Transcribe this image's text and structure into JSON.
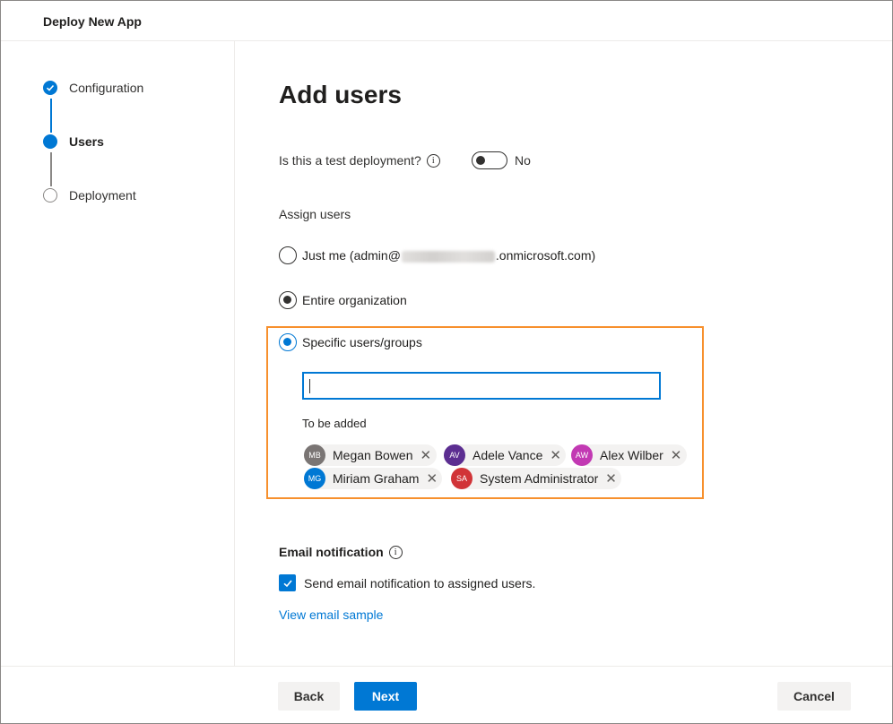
{
  "window": {
    "title": "Deploy New App"
  },
  "steps": [
    {
      "label": "Configuration",
      "state": "done"
    },
    {
      "label": "Users",
      "state": "current"
    },
    {
      "label": "Deployment",
      "state": "pending"
    }
  ],
  "main": {
    "title": "Add users",
    "test_deployment": {
      "label": "Is this a test deployment?",
      "toggle_label": "No",
      "enabled": false
    },
    "assign_label": "Assign users",
    "options": [
      {
        "label_prefix": "Just me (admin@",
        "label_suffix": ".onmicrosoft.com)",
        "selected": false
      },
      {
        "label": "Entire organization",
        "selected": false
      },
      {
        "label": "Specific users/groups",
        "selected": true
      }
    ],
    "search": {
      "value": "",
      "placeholder": ""
    },
    "to_be_added_label": "To be added",
    "users": [
      {
        "initials": "MB",
        "name": "Megan Bowen",
        "color": "#7a7574"
      },
      {
        "initials": "AV",
        "name": "Adele Vance",
        "color": "#5c2e91"
      },
      {
        "initials": "AW",
        "name": "Alex Wilber",
        "color": "#c239b3"
      },
      {
        "initials": "MG",
        "name": "Miriam Graham",
        "color": "#0078d4"
      },
      {
        "initials": "SA",
        "name": "System Administrator",
        "color": "#d13438"
      }
    ],
    "email": {
      "heading": "Email notification",
      "checkbox_label": "Send email notification to assigned users.",
      "checked": true,
      "link": "View email sample"
    }
  },
  "footer": {
    "back": "Back",
    "next": "Next",
    "cancel": "Cancel"
  },
  "colors": {
    "accent": "#0078d4",
    "highlight": "#f7902d"
  }
}
